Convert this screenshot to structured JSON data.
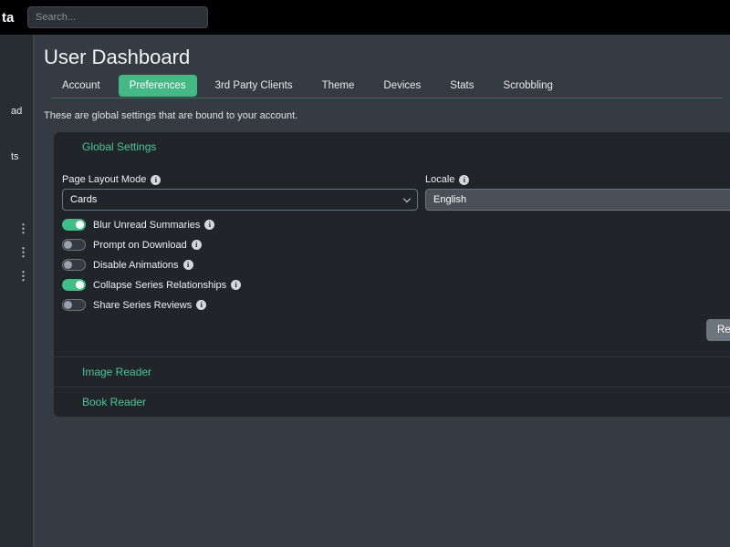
{
  "topbar": {
    "logo_fragment": "ta",
    "search_placeholder": "Search..."
  },
  "sidebar": {
    "truncated_labels": [
      "ad",
      "ts"
    ],
    "kebab_glyph": "⋮"
  },
  "page": {
    "title": "User Dashboard",
    "description": "These are global settings that are bound to your account."
  },
  "tabs": [
    {
      "label": "Account",
      "active": false
    },
    {
      "label": "Preferences",
      "active": true
    },
    {
      "label": "3rd Party Clients",
      "active": false
    },
    {
      "label": "Theme",
      "active": false
    },
    {
      "label": "Devices",
      "active": false
    },
    {
      "label": "Stats",
      "active": false
    },
    {
      "label": "Scrobbling",
      "active": false
    }
  ],
  "global_settings": {
    "section_title": "Global Settings",
    "page_layout_mode": {
      "label": "Page Layout Mode",
      "value": "Cards"
    },
    "locale": {
      "label": "Locale",
      "value": "English"
    },
    "toggles": [
      {
        "label": "Blur Unread Summaries",
        "on": true
      },
      {
        "label": "Prompt on Download",
        "on": false
      },
      {
        "label": "Disable Animations",
        "on": false
      },
      {
        "label": "Collapse Series Relationships",
        "on": true
      },
      {
        "label": "Share Series Reviews",
        "on": false
      }
    ],
    "reset_label": "Reset"
  },
  "sections": [
    {
      "title": "Image Reader"
    },
    {
      "title": "Book Reader"
    }
  ],
  "colors": {
    "accent_green": "#4ac694",
    "tab_active_bg": "#45b985",
    "toggle_on": "#41bd86",
    "card_bg": "#212529",
    "page_bg": "#353b43",
    "topbar_bg": "#000000"
  }
}
